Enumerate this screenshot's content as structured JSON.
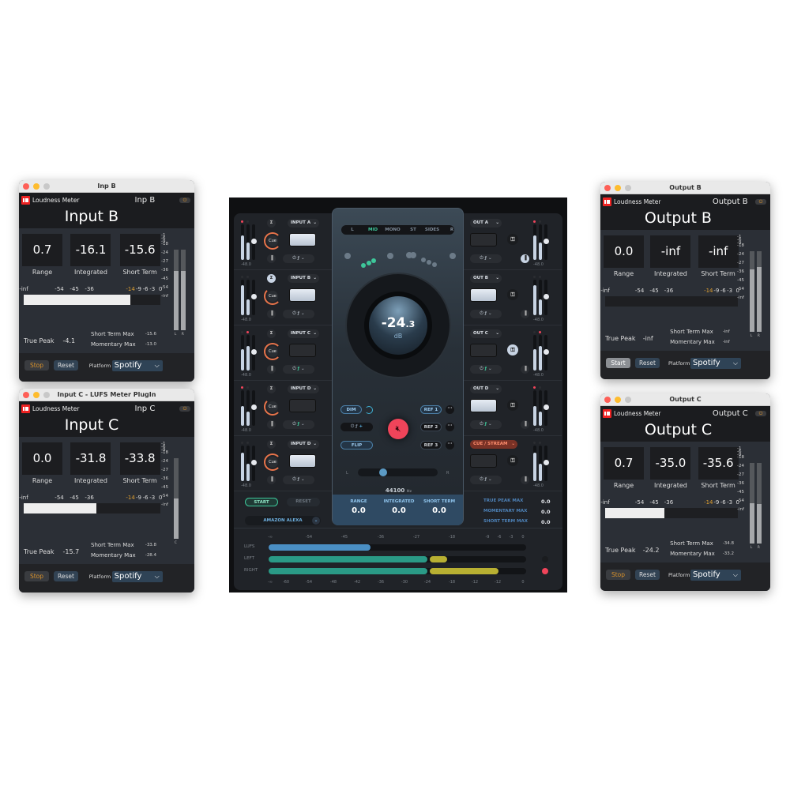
{
  "panels": [
    {
      "window_title": "Inp B",
      "app_name": "Loudness Meter",
      "plugin_name": "Inp B",
      "title": "Input B",
      "range": "0.7",
      "integrated": "-16.1",
      "short_term": "-15.6",
      "range_label": "Range",
      "integrated_label": "Integrated",
      "short_term_label": "Short Term",
      "true_peak_label": "True Peak",
      "true_peak": "-4.1",
      "short_term_max_label": "Short Term Max",
      "short_term_max": "-15.6",
      "momentary_max_label": "Momentary Max",
      "momentary_max": "-13.0",
      "bar_level": 0.78,
      "channels": [
        {
          "name": "L",
          "level": 0.74
        },
        {
          "name": "R",
          "level": 0.74
        }
      ],
      "run_button": "Stop",
      "run_state": "running",
      "reset_button": "Reset",
      "platform_label": "Platform",
      "platform": "Spotify"
    },
    {
      "window_title": "Input C - LUFS Meter PlugIn",
      "app_name": "Loudness Meter",
      "plugin_name": "Inp C",
      "title": "Input C",
      "range": "0.0",
      "integrated": "-31.8",
      "short_term": "-33.8",
      "range_label": "Range",
      "integrated_label": "Integrated",
      "short_term_label": "Short Term",
      "true_peak_label": "True Peak",
      "true_peak": "-15.7",
      "short_term_max_label": "Short Term Max",
      "short_term_max": "-33.8",
      "momentary_max_label": "Momentary Max",
      "momentary_max": "-28.4",
      "bar_level": 0.53,
      "channels": [
        {
          "name": "C",
          "level": 0.5
        }
      ],
      "run_button": "Stop",
      "run_state": "running",
      "reset_button": "Reset",
      "platform_label": "Platform",
      "platform": "Spotify"
    },
    {
      "window_title": "Output B",
      "app_name": "Loudness Meter",
      "plugin_name": "Output B",
      "title": "Output B",
      "range": "0.0",
      "integrated": "-inf",
      "short_term": "-inf",
      "range_label": "Range",
      "integrated_label": "Integrated",
      "short_term_label": "Short Term",
      "true_peak_label": "True Peak",
      "true_peak": "-inf",
      "short_term_max_label": "Short Term Max",
      "short_term_max": "-inf",
      "momentary_max_label": "Momentary Max",
      "momentary_max": "-inf",
      "bar_level": 0,
      "channels": [
        {
          "name": "L",
          "level": 0.77
        },
        {
          "name": "R",
          "level": 0.8
        }
      ],
      "run_button": "Start",
      "run_state": "stopped",
      "reset_button": "Reset",
      "platform_label": "Platform",
      "platform": "Spotify"
    },
    {
      "window_title": "Output C",
      "app_name": "Loudness Meter",
      "plugin_name": "Output C",
      "title": "Output C",
      "range": "0.7",
      "integrated": "-35.0",
      "short_term": "-35.6",
      "range_label": "Range",
      "integrated_label": "Integrated",
      "short_term_label": "Short Term",
      "true_peak_label": "True Peak",
      "true_peak": "-24.2",
      "short_term_max_label": "Short Term Max",
      "short_term_max": "-34.8",
      "momentary_max_label": "Momentary Max",
      "momentary_max": "-33.2",
      "bar_level": 0.45,
      "channels": [
        {
          "name": "L",
          "level": 0.5
        },
        {
          "name": "R",
          "level": 0.49
        }
      ],
      "run_button": "Stop",
      "run_state": "running",
      "reset_button": "Reset",
      "platform_label": "Platform",
      "platform": "Spotify"
    }
  ],
  "panel_scale_h": [
    "-inf",
    "-54",
    "-45",
    "-36",
    "-14",
    "-9",
    "-6",
    "-3",
    "0"
  ],
  "panel_scale_v": [
    "-1",
    "-6",
    "-9",
    "-18",
    "-24",
    "-27",
    "-36",
    "-45",
    "-54",
    "-inf"
  ],
  "monitor": {
    "inputs": [
      {
        "name": "INPUT A",
        "level": "-48.0",
        "cue": "Cue"
      },
      {
        "name": "INPUT B",
        "level": "-48.0",
        "cue": "Cue"
      },
      {
        "name": "INPUT C",
        "level": "-48.0",
        "cue": "Cue"
      },
      {
        "name": "INPUT D",
        "level": "-48.0",
        "cue": "Cue"
      },
      {
        "name": "INPUT D",
        "level": "-48.0",
        "cue": "Cue"
      }
    ],
    "outputs": [
      {
        "name": "OUT A",
        "level": "-48.0"
      },
      {
        "name": "OUT B",
        "level": "-48.0"
      },
      {
        "name": "OUT C",
        "level": "-48.0"
      },
      {
        "name": "OUT D",
        "level": "-48.0"
      },
      {
        "name": "CUE / STREAM",
        "level": "-48.0"
      }
    ],
    "modes": [
      "L",
      "MID",
      "MONO",
      "ST",
      "SIDES",
      "R"
    ],
    "active_mode": "MID",
    "volume": {
      "main": "-24",
      "decimal": ".3",
      "unit": "dB"
    },
    "buttons": {
      "dim": "DIM",
      "flip": "FLIP",
      "ref1": "REF 1",
      "ref2": "REF 2",
      "ref3": "REF 3",
      "start": "START",
      "reset": "RESET"
    },
    "pan": {
      "left": "L",
      "right": "R",
      "value": 0.3
    },
    "sample_rate": "44100",
    "sample_rate_unit": "Hz",
    "readout": [
      {
        "label": "RANGE",
        "value": "0.0"
      },
      {
        "label": "INTEGRATED",
        "value": "0.0"
      },
      {
        "label": "SHORT TERM",
        "value": "0.0"
      }
    ],
    "platform": "AMAZON ALEXA",
    "max_stats": [
      {
        "label": "TRUE PEAK MAX",
        "value": "0.0"
      },
      {
        "label": "MOMENTARY MAX",
        "value": "0.0"
      },
      {
        "label": "SHORT TERM MAX",
        "value": "0.0"
      }
    ],
    "meters": {
      "labels": [
        "LUFS",
        "LEFT",
        "RIGHT"
      ],
      "top_scale": [
        "-∞",
        "-54",
        "-45",
        "-36",
        "-27",
        "-18",
        "-9",
        "-6",
        "-3",
        "0"
      ],
      "bottom_scale": [
        "-∞",
        "-60",
        "-54",
        "-48",
        "-42",
        "-36",
        "-30",
        "-24",
        "-18",
        "-12",
        "-12",
        "0"
      ]
    },
    "colors": {
      "accent_green": "#3ec79a",
      "mute_red": "#f0445a",
      "cue_orange": "#e8744a",
      "lufs_blue": "#4a8fc4"
    }
  }
}
